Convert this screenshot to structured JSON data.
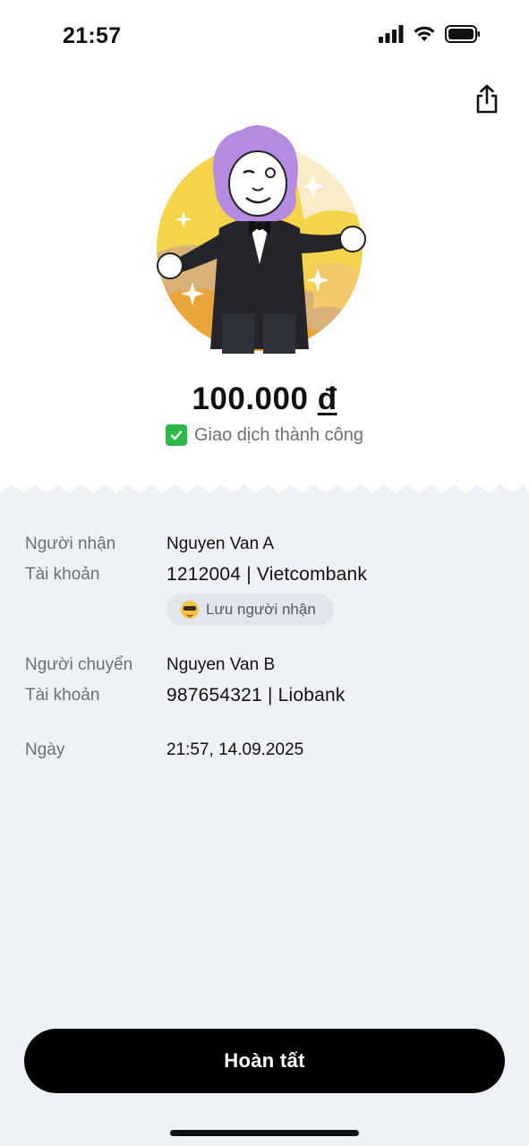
{
  "status_bar": {
    "time": "21:57"
  },
  "receipt": {
    "amount": "100.000",
    "currency": "đ",
    "status_text": "Giao dịch thành công"
  },
  "recipient": {
    "name_label": "Người nhận",
    "name": "Nguyen Van A",
    "account_label": "Tài khoản",
    "account": "1212004 | Vietcombank",
    "save_label": "Lưu người nhận"
  },
  "sender": {
    "name_label": "Người chuyển",
    "name": "Nguyen Van B",
    "account_label": "Tài khoản",
    "account": "987654321 | Liobank"
  },
  "date": {
    "label": "Ngày",
    "value": "21:57, 14.09.2025"
  },
  "actions": {
    "done_label": "Hoàn tất"
  },
  "colors": {
    "background_details": "#eef1f5",
    "success_green": "#2fb94a",
    "button": "#000000",
    "mascot_purple": "#b48be0",
    "mascot_bg_yellow": "#f5d34a"
  },
  "icons": [
    "signal-icon",
    "wifi-icon",
    "battery-icon",
    "share-icon",
    "check-icon",
    "sunglasses-emoji-icon"
  ]
}
